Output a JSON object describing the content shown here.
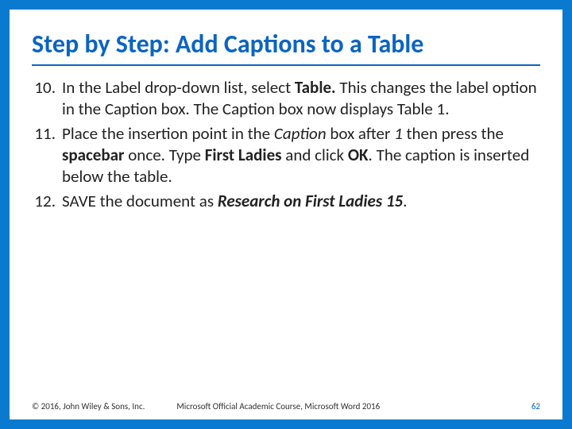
{
  "title": "Step by Step: Add Captions to a Table",
  "items": [
    {
      "num": "10.",
      "html": "In the Label drop-down list, select <b>Table.</b> This changes the label option in the Caption box. The Caption box now displays Table 1."
    },
    {
      "num": "11.",
      "html": "Place the insertion point in the <i>Caption</i> box after <i>1</i> then press the <b>spacebar</b> once. Type <b>First Ladies</b> and click <b>OK</b>. The caption is inserted below the table."
    },
    {
      "num": "12.",
      "html": "SAVE the document as <span class=\"bi\">Research on First Ladies 15</span>."
    }
  ],
  "footer": {
    "copyright": "© 2016, John Wiley & Sons, Inc.",
    "course": "Microsoft Official Academic Course, Microsoft Word 2016",
    "page": "62"
  }
}
